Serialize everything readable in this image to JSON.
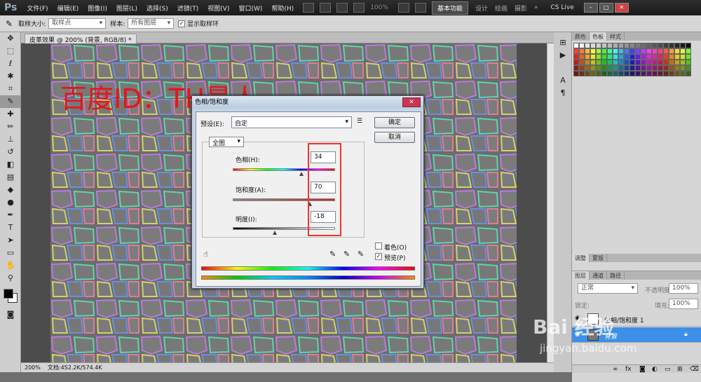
{
  "menubar": {
    "logo": "Ps",
    "items": [
      "文件(F)",
      "编辑(E)",
      "图像(I)",
      "图层(L)",
      "选择(S)",
      "滤镜(T)",
      "视图(V)",
      "窗口(W)",
      "帮助(H)"
    ],
    "zoom": "100%",
    "workspace_active": "基本功能",
    "workspaces": [
      "设计",
      "绘画",
      "摄影"
    ],
    "more": "»",
    "cslive": "CS Live"
  },
  "options": {
    "sample_size_label": "取样大小:",
    "sample_size_value": "取样点",
    "sample_label": "样本:",
    "sample_value": "所有图层",
    "show_ring_label": "显示取样环"
  },
  "document": {
    "tab": "皮革效果 @ 200% (背景, RGB/8) *",
    "watermark": "百度ID：TH最人"
  },
  "status": {
    "zoom": "200%",
    "doc": "文档:452.2K/574.4K"
  },
  "panels": {
    "swatch_tabs": [
      "颜色",
      "色板",
      "样式"
    ],
    "adjust_tabs": [
      "调整",
      "蒙版"
    ],
    "layer_tabs": [
      "图层",
      "通道",
      "路径"
    ],
    "blend_mode": "正常",
    "opacity_label": "不透明度:",
    "opacity_value": "100%",
    "lock_label": "锁定:",
    "fill_label": "填充:",
    "fill_value": "100%",
    "layer_top": "色相/饱和度 1",
    "layer_bg": "背景"
  },
  "dialog": {
    "title": "色相/饱和度",
    "close": "✕",
    "preset_label": "预设(E):",
    "preset_value": "自定",
    "ok": "确定",
    "cancel": "取消",
    "channel": "全图",
    "hue_label": "色相(H):",
    "hue_value": "34",
    "saturation_label": "饱和度(A):",
    "saturation_value": "70",
    "lightness_label": "明度(I):",
    "lightness_value": "-18",
    "colorize_label": "着色(O)",
    "preview_label": "预览(P)"
  },
  "watermark": {
    "brand": "Bai 经验",
    "url": "jingyan.baidu.com"
  }
}
